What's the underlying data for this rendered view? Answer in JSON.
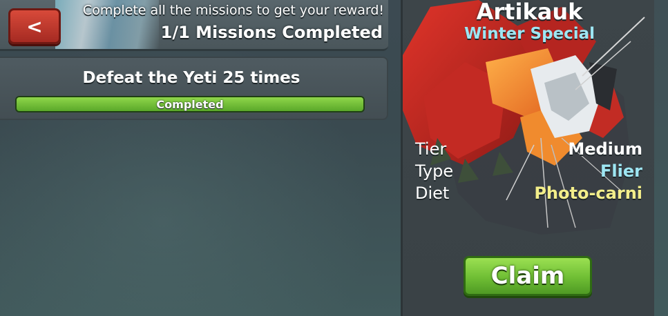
{
  "header": {
    "back_label": "<",
    "instruction": "Complete all the missions to get your reward!",
    "progress_text": "1/1 Missions Completed"
  },
  "missions": [
    {
      "title": "Defeat the Yeti 25 times",
      "status": "Completed",
      "progress": 1.0
    }
  ],
  "reward": {
    "name": "Artikauk",
    "event": "Winter Special",
    "stats": [
      {
        "label": "Tier",
        "value": "Medium",
        "color": "#ffffff"
      },
      {
        "label": "Type",
        "value": "Flier",
        "color": "#9ee6f3"
      },
      {
        "label": "Diet",
        "value": "Photo-carni",
        "color": "#f3ee8a"
      }
    ],
    "claim_label": "Claim"
  },
  "colors": {
    "accent_green": "#6fbe34",
    "back_red": "#c13a2e",
    "event_cyan": "#9ee6f3",
    "diet_yellow": "#f3ee8a"
  }
}
